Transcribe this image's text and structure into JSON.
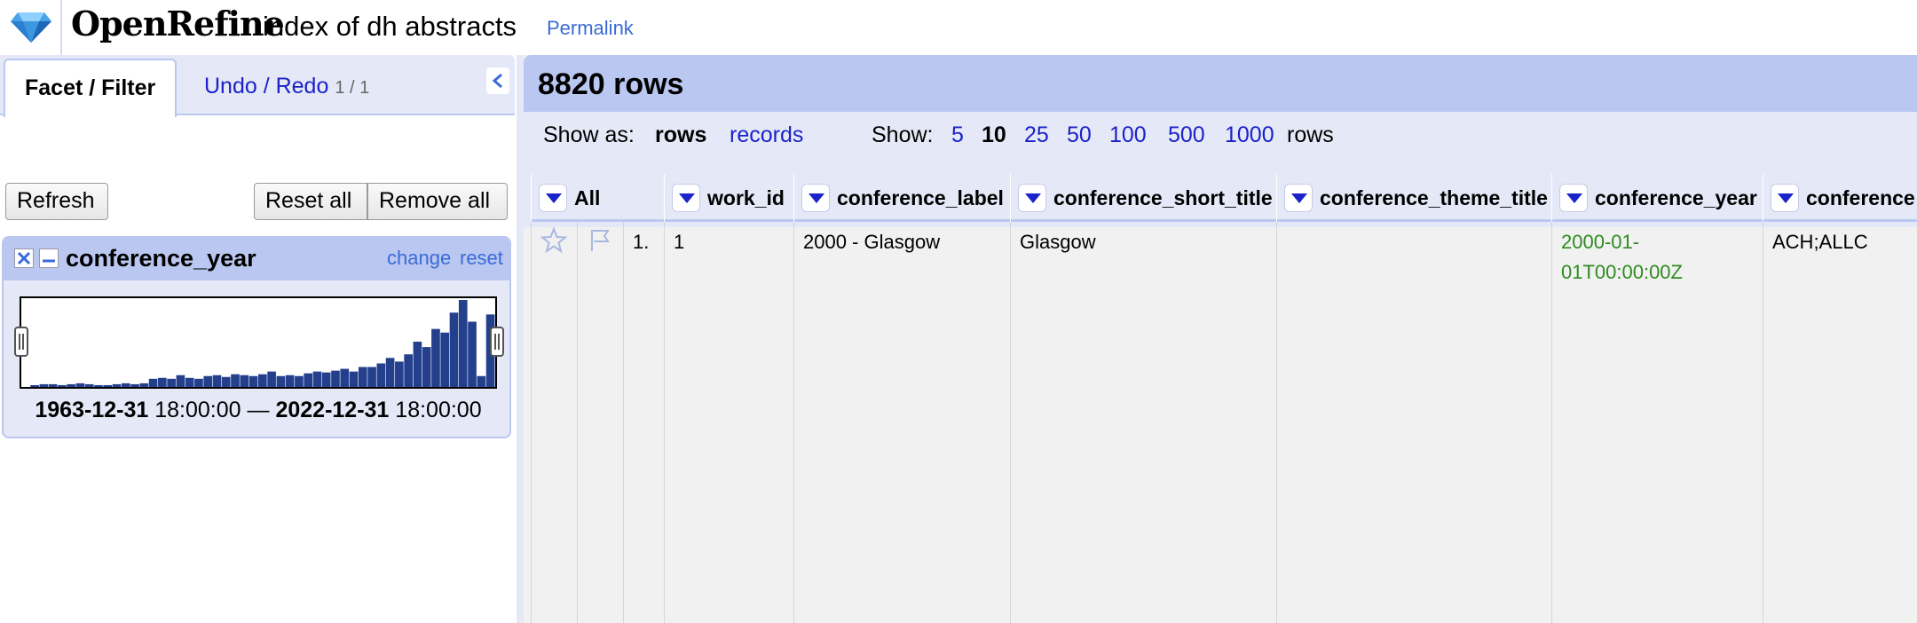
{
  "header": {
    "brand": "OpenRefine",
    "project_name": "index of dh abstracts",
    "permalink": "Permalink"
  },
  "left_panel": {
    "tabs": [
      {
        "label": "Facet / Filter",
        "active": true
      },
      {
        "label": "Undo / Redo",
        "count": "1 / 1",
        "active": false
      }
    ],
    "buttons": {
      "refresh": "Refresh",
      "reset_all": "Reset all",
      "remove_all": "Remove all"
    },
    "facet": {
      "title": "conference_year",
      "change": "change",
      "reset": "reset",
      "range_from_date": "1963-12-31",
      "range_from_time": "18:00:00",
      "range_sep": "—",
      "range_to_date": "2022-12-31",
      "range_to_time": "18:00:00",
      "histogram_values": [
        0,
        2,
        3,
        3,
        2,
        3,
        4,
        3,
        2,
        2,
        3,
        4,
        3,
        4,
        9,
        10,
        9,
        13,
        10,
        9,
        12,
        13,
        11,
        14,
        13,
        12,
        14,
        17,
        12,
        13,
        12,
        15,
        17,
        16,
        18,
        20,
        17,
        22,
        22,
        26,
        32,
        28,
        36,
        50,
        44,
        64,
        60,
        82,
        96,
        72,
        12,
        80
      ]
    }
  },
  "right_panel": {
    "row_count": "8820 rows",
    "show_as_label": "Show as:",
    "show_as_options": [
      {
        "label": "rows",
        "active": true
      },
      {
        "label": "records",
        "active": false
      }
    ],
    "show_label": "Show:",
    "page_sizes": [
      {
        "label": "5",
        "active": false
      },
      {
        "label": "10",
        "active": true
      },
      {
        "label": "25",
        "active": false
      },
      {
        "label": "50",
        "active": false
      },
      {
        "label": "100",
        "active": false
      },
      {
        "label": "500",
        "active": false
      },
      {
        "label": "1000",
        "active": false
      }
    ],
    "rows_suffix": "rows",
    "columns": [
      "All",
      "work_id",
      "conference_label",
      "conference_short_title",
      "conference_theme_title",
      "conference_year",
      "conference"
    ],
    "rows": [
      {
        "index": "1.",
        "work_id": "1",
        "conference_label": "2000 - Glasgow",
        "conference_short_title": "Glasgow",
        "conference_theme_title": "",
        "conference_year": "2000-01-01T00:00:00Z",
        "conference_year_line1": "2000-01-",
        "conference_year_line2": "01T00:00:00Z",
        "conference": "ACH;ALLC"
      }
    ]
  },
  "colors": {
    "accent": "#bac7f0",
    "panel_bg": "#e5e9f7",
    "link": "#1a22c9",
    "histogram_bar": "#243f8c",
    "date_value": "#2e8b1f"
  }
}
